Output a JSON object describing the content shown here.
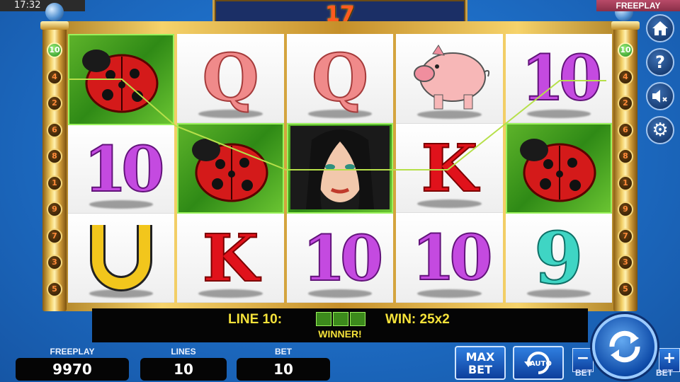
{
  "status": {
    "clock": "17:32",
    "mode_badge": "FREEPLAY"
  },
  "top_counter": "17",
  "line_markers": {
    "left": [
      "10",
      "4",
      "2",
      "6",
      "8",
      "1",
      "9",
      "7",
      "3",
      "5"
    ],
    "right": [
      "10",
      "4",
      "2",
      "6",
      "8",
      "1",
      "9",
      "7",
      "3",
      "5"
    ],
    "active": "10"
  },
  "reels": [
    [
      {
        "symbol": "ladybug",
        "label": ""
      },
      {
        "symbol": "ten",
        "label": "10"
      },
      {
        "symbol": "horseshoe",
        "label": ""
      }
    ],
    [
      {
        "symbol": "queen",
        "label": "Q"
      },
      {
        "symbol": "ladybug",
        "label": ""
      },
      {
        "symbol": "king",
        "label": "K"
      }
    ],
    [
      {
        "symbol": "queen",
        "label": "Q"
      },
      {
        "symbol": "woman",
        "label": ""
      },
      {
        "symbol": "ten",
        "label": "10"
      }
    ],
    [
      {
        "symbol": "pig",
        "label": ""
      },
      {
        "symbol": "king",
        "label": "K"
      },
      {
        "symbol": "ten",
        "label": "10"
      }
    ],
    [
      {
        "symbol": "ten",
        "label": "10"
      },
      {
        "symbol": "ladybug",
        "label": ""
      },
      {
        "symbol": "nine",
        "label": "9"
      }
    ]
  ],
  "winning_cells": [
    [
      0,
      0
    ],
    [
      1,
      1
    ],
    [
      2,
      1
    ],
    [
      4,
      1
    ]
  ],
  "message": {
    "line": "LINE 10:",
    "win": "WIN: 25x2",
    "winner": "WINNER!"
  },
  "panels": {
    "freeplay": {
      "label": "FREEPLAY",
      "value": "9970"
    },
    "lines": {
      "label": "LINES",
      "value": "10"
    },
    "bet": {
      "label": "BET",
      "value": "10"
    }
  },
  "buttons": {
    "max_bet": "MAX BET",
    "auto": "AUTO",
    "bet_minus": "BET",
    "bet_plus": "BET",
    "minus": "−",
    "plus": "+"
  },
  "side_icons": [
    "home-icon",
    "help-icon",
    "sound-muted-icon",
    "settings-icon"
  ],
  "colors": {
    "win_line": "#b6e04a",
    "message_text": "#f5e23a",
    "counter": "#ff5a1f"
  }
}
